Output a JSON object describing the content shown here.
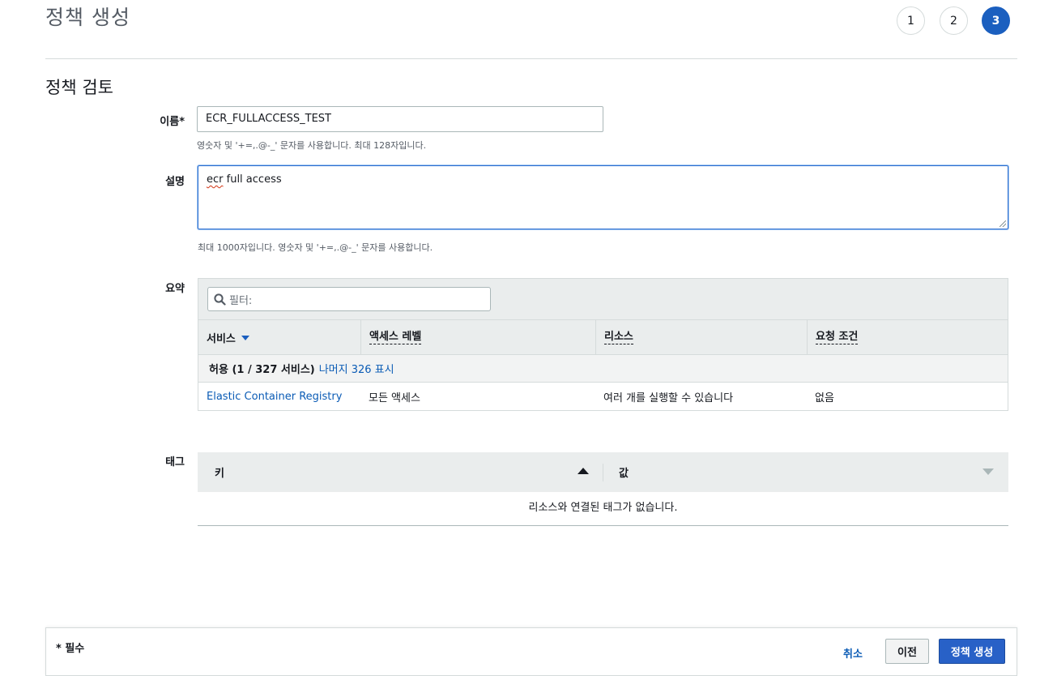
{
  "header": {
    "title": "정책 생성",
    "steps": [
      "1",
      "2",
      "3"
    ],
    "active_step": "3"
  },
  "section_title": "정책 검토",
  "form": {
    "name_label": "이름*",
    "name_value": "ECR_FULLACCESS_TEST",
    "name_hint": "영숫자 및 '+=,.@-_' 문자를 사용합니다. 최대 128자입니다.",
    "desc_label": "설명",
    "desc_value_misspelled": "ecr",
    "desc_value_rest": " full access",
    "desc_hint": "최대 1000자입니다. 영숫자 및 '+=,.@-_' 문자를 사용합니다."
  },
  "summary": {
    "label": "요약",
    "filter_placeholder": "필터:",
    "columns": [
      "서비스",
      "액세스 레벨",
      "리소스",
      "요청 조건"
    ],
    "group_row_bold": "허용 (1 / 327 서비스)",
    "group_row_link": "나머지 326 표시",
    "rows": [
      {
        "service": "Elastic Container Registry",
        "access_level": "모든 액세스",
        "resource": "여러 개를 실행할 수 있습니다",
        "condition": "없음"
      }
    ]
  },
  "tags": {
    "label": "태그",
    "key_header": "키",
    "value_header": "값",
    "empty_message": "리소스와 연결된 태그가 없습니다."
  },
  "footer": {
    "required_note": "* 필수",
    "cancel_label": "취소",
    "previous_label": "이전",
    "create_label": "정책 생성"
  },
  "colors": {
    "primary": "#2861c7",
    "link": "#0a5bb5",
    "active_step": "#1b5fbf"
  },
  "icons": {
    "filter": "search-icon",
    "sort": "caret-down-icon",
    "tag_sort_up": "caret-up-icon",
    "tag_sort_down": "caret-down-icon"
  }
}
